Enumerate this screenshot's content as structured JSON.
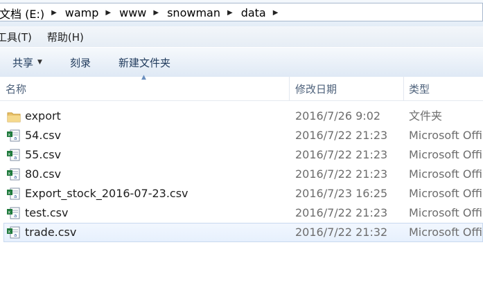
{
  "address": {
    "crumbs": [
      "文档 (E:)",
      "wamp",
      "www",
      "snowman",
      "data"
    ]
  },
  "menu": {
    "tools": "工具(T)",
    "help": "帮助(H)"
  },
  "toolbar": {
    "share": "共享",
    "burn": "刻录",
    "new_folder": "新建文件夹"
  },
  "columns": {
    "name": "名称",
    "date": "修改日期",
    "type": "类型"
  },
  "files": [
    {
      "name": "export",
      "date": "2016/7/26 9:02",
      "type": "文件夹",
      "icon": "folder-icon"
    },
    {
      "name": "54.csv",
      "date": "2016/7/22 21:23",
      "type": "Microsoft Offi",
      "icon": "csv-file-icon"
    },
    {
      "name": "55.csv",
      "date": "2016/7/22 21:23",
      "type": "Microsoft Offi",
      "icon": "csv-file-icon"
    },
    {
      "name": "80.csv",
      "date": "2016/7/22 21:23",
      "type": "Microsoft Offi",
      "icon": "csv-file-icon"
    },
    {
      "name": "Export_stock_2016-07-23.csv",
      "date": "2016/7/23 16:25",
      "type": "Microsoft Offi",
      "icon": "csv-file-icon"
    },
    {
      "name": "test.csv",
      "date": "2016/7/22 21:23",
      "type": "Microsoft Offi",
      "icon": "csv-file-icon"
    },
    {
      "name": "trade.csv",
      "date": "2016/7/22 21:32",
      "type": "Microsoft Offi",
      "icon": "csv-file-icon"
    }
  ],
  "colors": {
    "toolbar_text": "#1e395b",
    "header_text": "#4c607a",
    "selection": "#e6f0fd",
    "folder": "#e8c16a",
    "excel_green": "#1f7a3c"
  }
}
